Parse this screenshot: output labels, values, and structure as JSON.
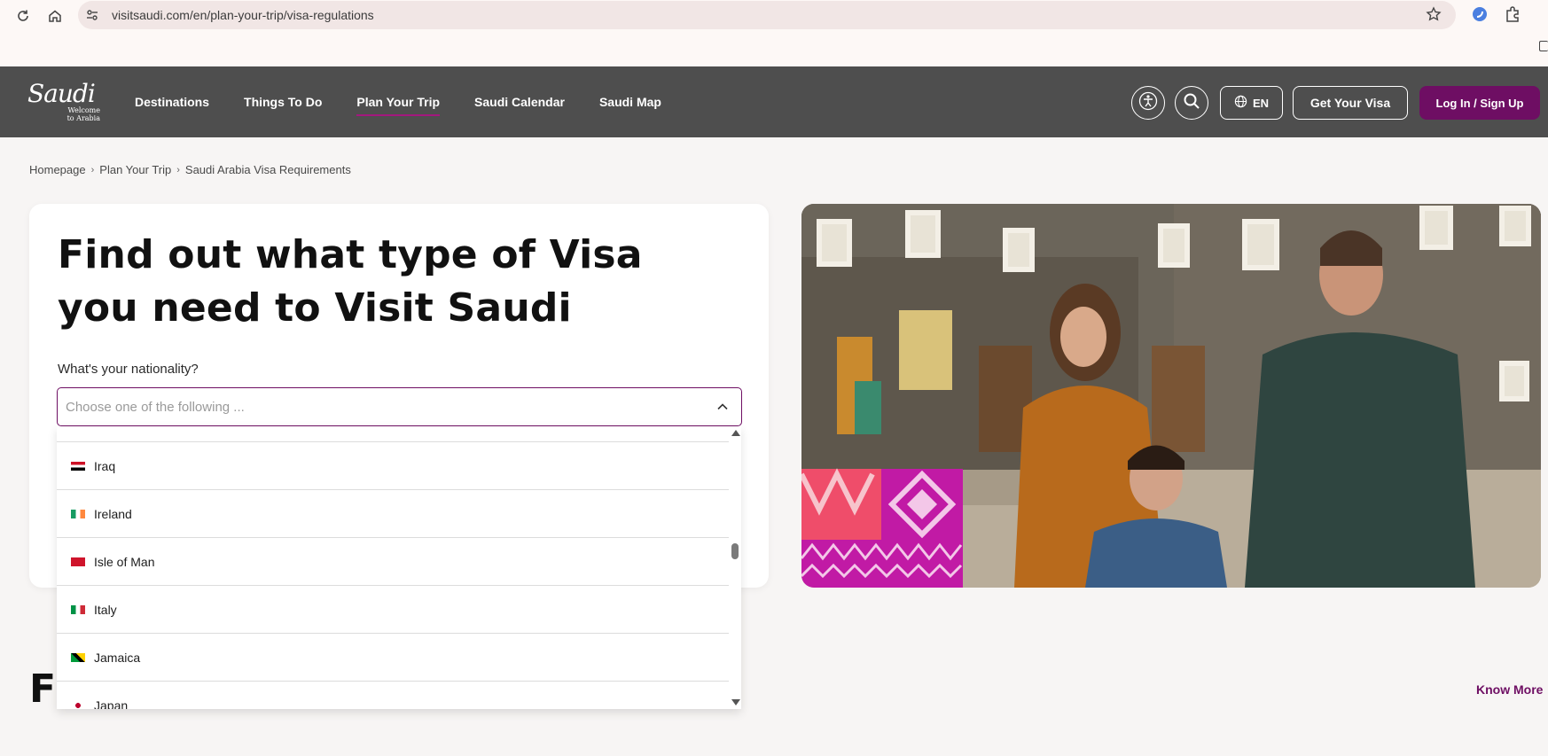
{
  "browser": {
    "url": "visitsaudi.com/en/plan-your-trip/visa-regulations"
  },
  "header": {
    "logo_text": "Saudi",
    "logo_sub_line1": "Welcome",
    "logo_sub_line2": "to Arabia",
    "nav": [
      {
        "label": "Destinations",
        "active": false
      },
      {
        "label": "Things To Do",
        "active": false
      },
      {
        "label": "Plan Your Trip",
        "active": true
      },
      {
        "label": "Saudi Calendar",
        "active": false
      },
      {
        "label": "Saudi Map",
        "active": false
      }
    ],
    "language": "EN",
    "visa_button": "Get Your Visa",
    "login_button": "Log In / Sign Up",
    "icons": [
      "accessibility-icon",
      "search-icon",
      "globe-icon"
    ]
  },
  "breadcrumb": [
    "Homepage",
    "Plan Your Trip",
    "Saudi Arabia Visa Requirements"
  ],
  "card": {
    "title": "Find out what type of Visa you need to Visit Saudi",
    "field_label": "What's your nationality?",
    "placeholder": "Choose one of the following ..."
  },
  "dropdown": {
    "options": [
      {
        "name": "",
        "flag": ""
      },
      {
        "name": "Iraq",
        "flag": "iraq"
      },
      {
        "name": "Ireland",
        "flag": "ireland"
      },
      {
        "name": "Isle of Man",
        "flag": "isle-of-man"
      },
      {
        "name": "Italy",
        "flag": "italy"
      },
      {
        "name": "Jamaica",
        "flag": "jamaica"
      },
      {
        "name": "Japan",
        "flag": "japan"
      }
    ]
  },
  "section": {
    "title_visible": "Fu",
    "know_more": "Know More"
  },
  "colors": {
    "brand_purple": "#6e0e63",
    "header_bg": "#4e4e4e",
    "page_bg": "#f7f5f4"
  }
}
